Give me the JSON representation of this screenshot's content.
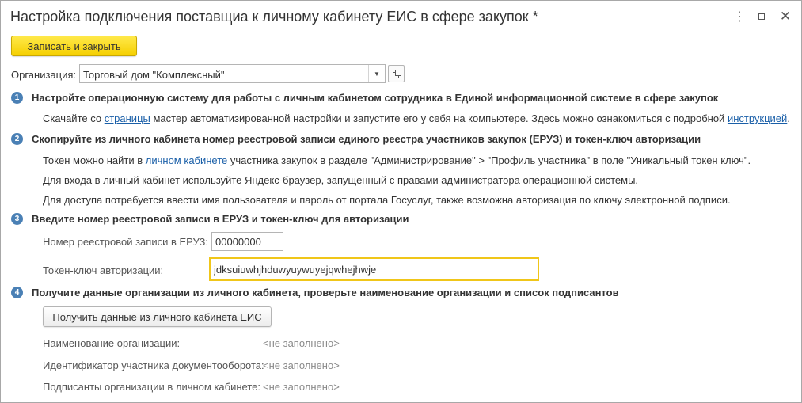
{
  "window": {
    "title": "Настройка подключения поставщиа к личному кабинету ЕИС в сфере закупок *",
    "more_glyph": "⋮",
    "close_glyph": "✕"
  },
  "toolbar": {
    "save_close_label": "Записать и закрыть"
  },
  "organization": {
    "label": "Организация:",
    "value": "Торговый дом \"Комплексный\"",
    "dropdown_glyph": "▼"
  },
  "steps": [
    {
      "number": "1",
      "title": "Настройте операционную систему для работы с личным кабинетом сотрудника в Единой информационной системе в сфере закупок",
      "line1_before": "Скачайте со ",
      "line1_link": "страницы",
      "line1_middle": " мастер автоматизированной настройки и запустите его у себя на компьютере. Здесь можно ознакомиться с подробной ",
      "line1_link2": "инструкцией",
      "line1_after": "."
    },
    {
      "number": "2",
      "title": "Скопируйте из личного кабинета номер реестровой записи единого реестра участников закупок (ЕРУЗ) и токен-ключ авторизации",
      "line1_before": "Токен можно найти в ",
      "line1_link": "личном кабинете",
      "line1_after": " участника закупок в разделе \"Администрирование\" > \"Профиль участника\" в поле \"Уникальный токен ключ\".",
      "line2": "Для входа в личный кабинет используйте Яндекс-браузер, запущенный с правами администратора операционной системы.",
      "line3": "Для доступа потребуется ввести имя пользователя и пароль от портала Госуслуг, также возможна авторизация по ключу электронной подписи."
    },
    {
      "number": "3",
      "title": "Введите номер реестровой записи в ЕРУЗ и токен-ключ для авторизации",
      "eruz_label": "Номер реестровой записи в ЕРУЗ:",
      "eruz_value": "00000000",
      "token_label": "Токен-ключ авторизации:",
      "token_value": "jdksuiuwhjhduwyuywuyejqwhejhwje"
    },
    {
      "number": "4",
      "title": "Получите данные организации из личного кабинета, проверьте наименование организации и список подписантов",
      "button_label": "Получить данные из личного кабинета ЕИС",
      "org_name_label": "Наименование организации:",
      "org_name_value": "<не заполнено>",
      "participant_id_label": "Идентификатор участника документооборота:",
      "participant_id_value": "<не заполнено>",
      "signers_label": "Подписанты организации в личном кабинете:",
      "signers_value": "<не заполнено>"
    }
  ],
  "colors": {
    "primary_button": "#f5cf00",
    "step_badge": "#4a80b5",
    "link": "#1a5fa8",
    "focus_border": "#f0c619"
  }
}
